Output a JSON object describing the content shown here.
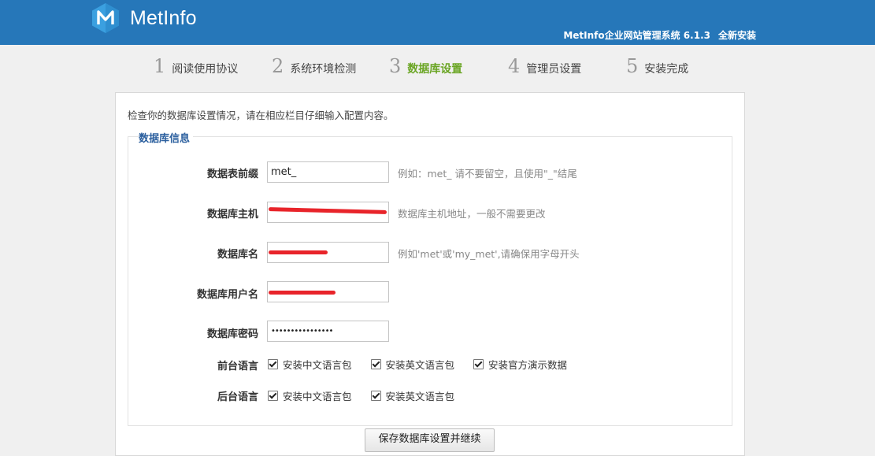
{
  "header": {
    "brand": "MetInfo",
    "system_name": "MetInfo企业网站管理系统 6.1.3",
    "install_type": "全新安装",
    "brand_color": "#2677b9"
  },
  "steps": [
    {
      "num": "1",
      "label": "阅读使用协议"
    },
    {
      "num": "2",
      "label": "系统环境检测"
    },
    {
      "num": "3",
      "label": "数据库设置",
      "active": true
    },
    {
      "num": "4",
      "label": "管理员设置"
    },
    {
      "num": "5",
      "label": "安装完成"
    }
  ],
  "intro": "检查你的数据库设置情况，请在相应栏目仔细输入配置内容。",
  "section_title": "数据库信息",
  "fields": {
    "prefix": {
      "label": "数据表前缀",
      "value": "met_",
      "hint": "例如：met_ 请不要留空，且使用\"_\"结尾"
    },
    "host": {
      "label": "数据库主机",
      "value": "",
      "hint": "数据库主机地址，一般不需要更改"
    },
    "dbname": {
      "label": "数据库名",
      "value": "",
      "hint": "例如'met'或'my_met',请确保用字母开头"
    },
    "user": {
      "label": "数据库用户名",
      "value": ""
    },
    "password": {
      "label": "数据库密码",
      "value": "••••••••••••••••"
    }
  },
  "frontend_lang": {
    "label": "前台语言",
    "options": [
      {
        "label": "安装中文语言包",
        "checked": true
      },
      {
        "label": "安装英文语言包",
        "checked": true
      },
      {
        "label": "安装官方演示数据",
        "checked": true
      }
    ]
  },
  "backend_lang": {
    "label": "后台语言",
    "options": [
      {
        "label": "安装中文语言包",
        "checked": true
      },
      {
        "label": "安装英文语言包",
        "checked": true
      }
    ]
  },
  "submit_label": "保存数据库设置并继续"
}
